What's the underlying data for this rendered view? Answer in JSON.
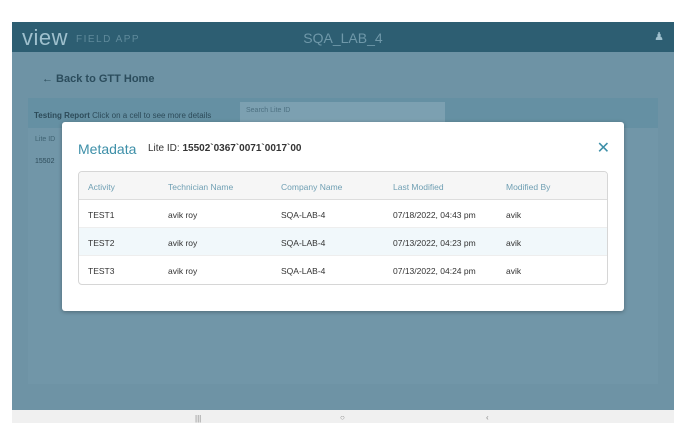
{
  "appbar": {
    "logo": "view",
    "subtitle": "FIELD APP",
    "title": "SQA_LAB_4",
    "user_icon": "user-icon"
  },
  "back_link": "← Back to GTT Home",
  "report": {
    "title": "Testing Report",
    "hint": "Click on a cell to see more details",
    "search_placeholder": "Search Lite ID",
    "col_label": "Lite ID",
    "first_value": "15502"
  },
  "modal": {
    "title": "Metadata",
    "id_label": "Lite ID:",
    "id_value": "15502`0367`0071`0017`00",
    "close": "✕",
    "columns": [
      "Activity",
      "Technician Name",
      "Company Name",
      "Last Modified",
      "Modified By"
    ],
    "rows": [
      [
        "TEST1",
        "avik roy",
        "SQA-LAB-4",
        "07/18/2022, 04:43 pm",
        "avik"
      ],
      [
        "TEST2",
        "avik roy",
        "SQA-LAB-4",
        "07/13/2022, 04:23 pm",
        "avik"
      ],
      [
        "TEST3",
        "avik roy",
        "SQA-LAB-4",
        "07/13/2022, 04:24 pm",
        "avik"
      ]
    ]
  },
  "navbar": {
    "recent": "|||",
    "home": "○",
    "back": "‹"
  }
}
